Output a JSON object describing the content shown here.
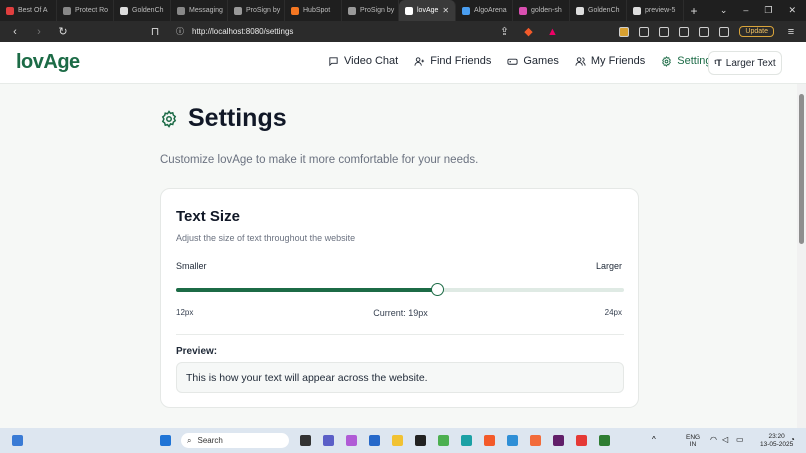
{
  "browser": {
    "tabs": [
      {
        "label": "Best Of A",
        "color": "#e03e3e",
        "active": false
      },
      {
        "label": "Protect Ro",
        "color": "#888888",
        "active": false
      },
      {
        "label": "GoldenCh",
        "color": "#dddddd",
        "active": false
      },
      {
        "label": "Messaging",
        "color": "#888888",
        "active": false
      },
      {
        "label": "ProSign by",
        "color": "#999999",
        "active": false
      },
      {
        "label": "HubSpot",
        "color": "#f57722",
        "active": false
      },
      {
        "label": "ProSign by",
        "color": "#999999",
        "active": false
      },
      {
        "label": "lovAge",
        "color": "#ffffff",
        "active": true
      },
      {
        "label": "AlgoArena",
        "color": "#4a9ef0",
        "active": false
      },
      {
        "label": "golden-sh",
        "color": "#d94fb0",
        "active": false
      },
      {
        "label": "GoldenCh",
        "color": "#dddddd",
        "active": false
      },
      {
        "label": "preview-5",
        "color": "#dddddd",
        "active": false
      }
    ],
    "url": "http://localhost:8080/settings",
    "update_label": "Update"
  },
  "app": {
    "logo": "lovAge",
    "nav": [
      {
        "label": "Video Chat",
        "icon": "chat-icon",
        "active": false
      },
      {
        "label": "Find Friends",
        "icon": "user-plus-icon",
        "active": false
      },
      {
        "label": "Games",
        "icon": "gamepad-icon",
        "active": false
      },
      {
        "label": "My Friends",
        "icon": "users-icon",
        "active": false
      },
      {
        "label": "Settings",
        "icon": "gear-icon",
        "active": true
      }
    ],
    "larger_text_button": "Larger Text",
    "accent": "#1c6b46"
  },
  "page": {
    "title": "Settings",
    "subtitle": "Customize lovAge to make it more comfortable for your needs."
  },
  "text_size": {
    "title": "Text Size",
    "description": "Adjust the size of text throughout the website",
    "smaller_label": "Smaller",
    "larger_label": "Larger",
    "min_label": "12px",
    "max_label": "24px",
    "current_label": "Current: 19px",
    "min": 12,
    "max": 24,
    "current": 19,
    "preview_label": "Preview:",
    "preview_text": "This is how your text will appear across the website."
  },
  "taskbar": {
    "search_placeholder": "Search",
    "lang_line1": "ENG",
    "lang_line2": "IN",
    "time": "23:20",
    "date": "13-05-2025"
  }
}
